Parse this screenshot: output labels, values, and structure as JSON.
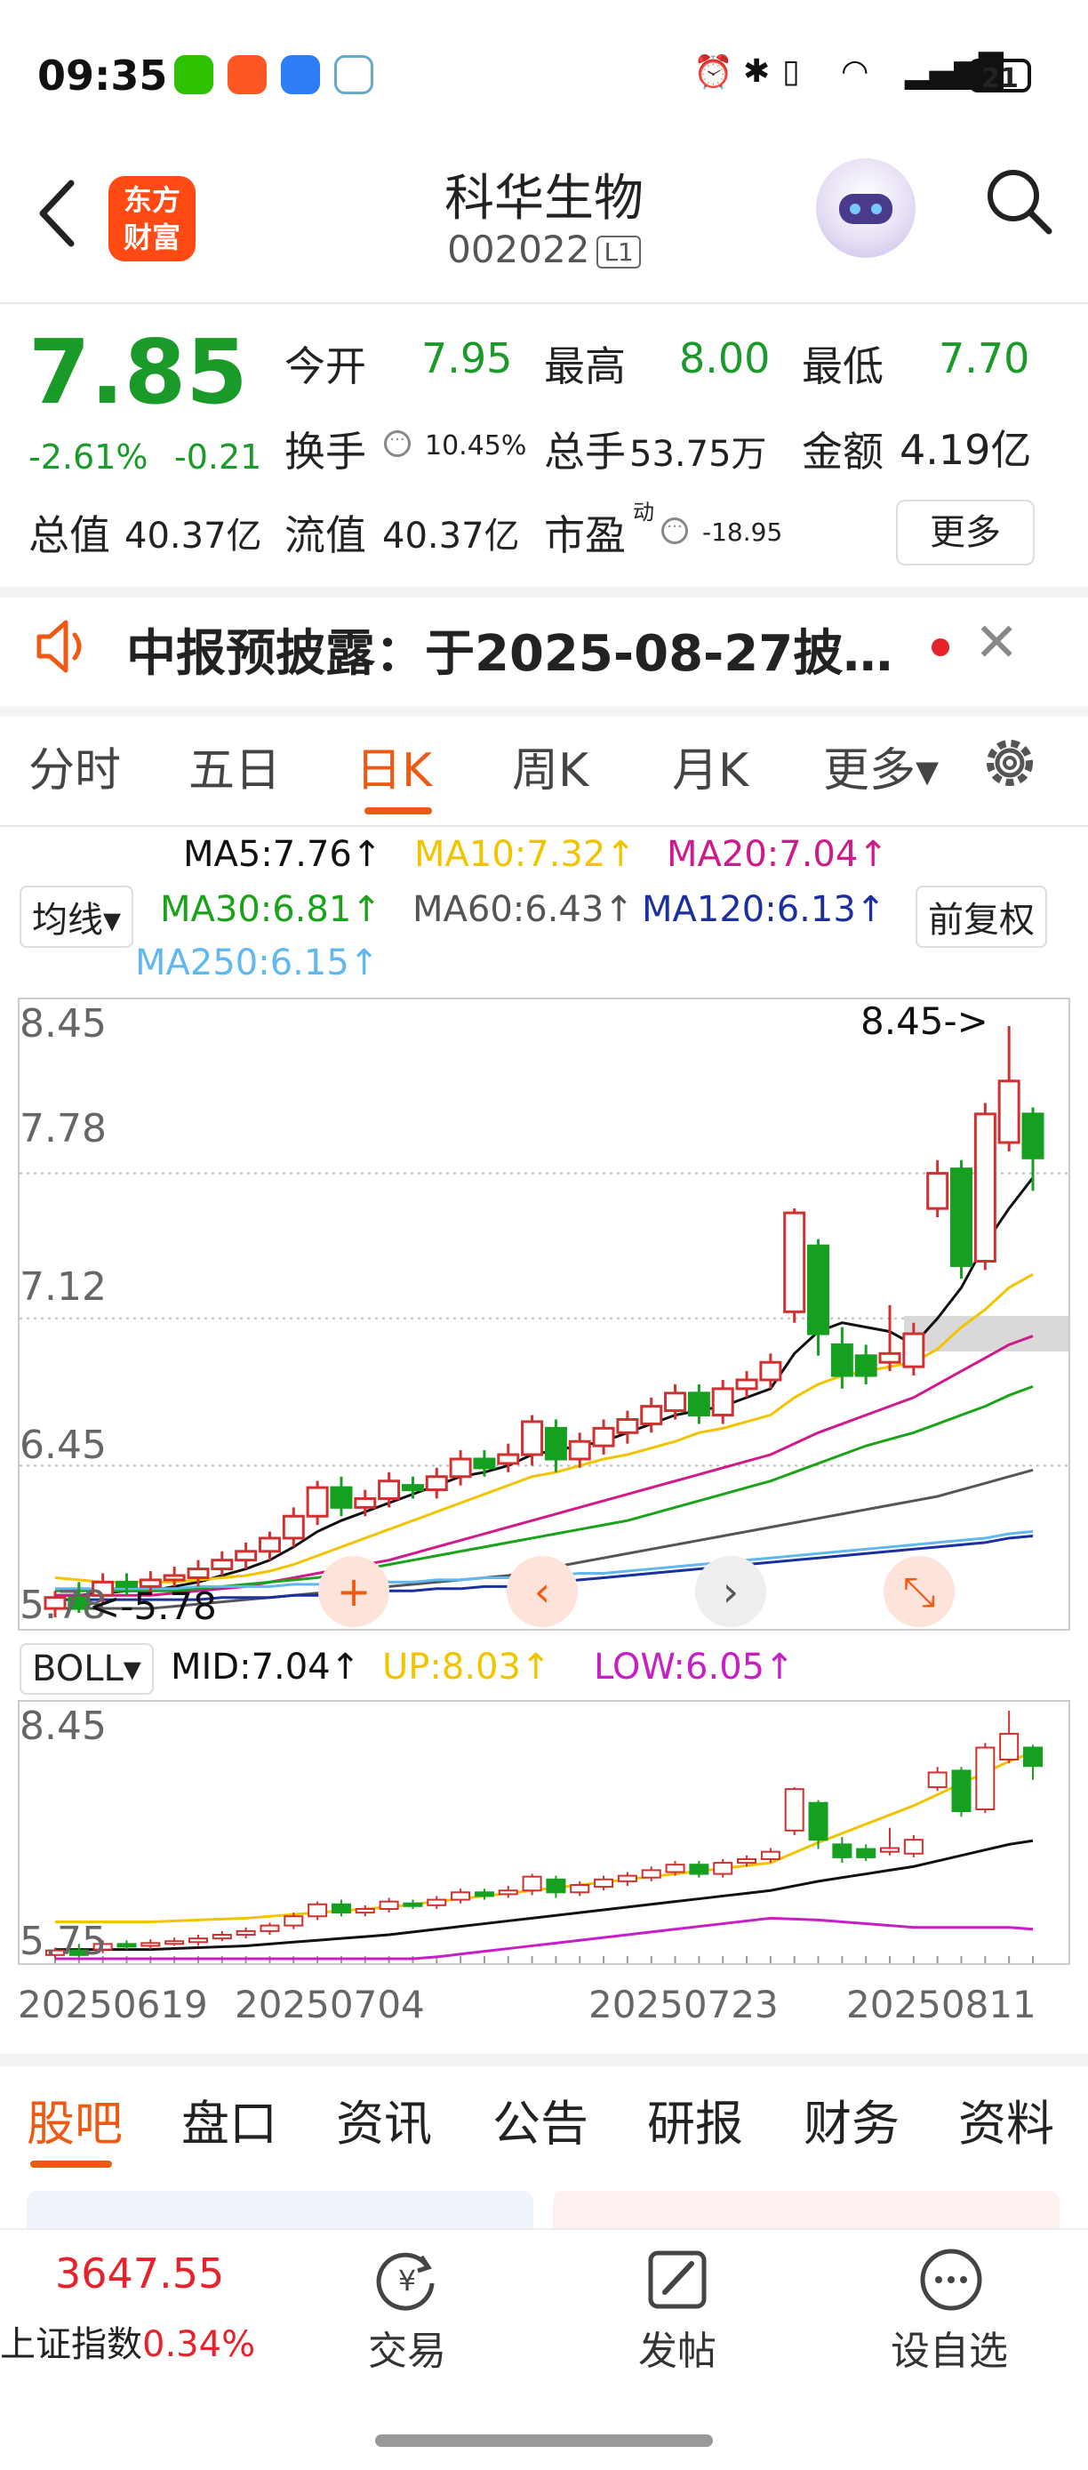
{
  "status_bar": {
    "time": "09:35",
    "battery": "21"
  },
  "header": {
    "back_icon": "chevron-left-icon",
    "logo_line1": "东方",
    "logo_line2": "财富",
    "title": "科华生物",
    "code": "002022",
    "badge": "L1"
  },
  "quote": {
    "price": "7.85",
    "change_pct": "-2.61%",
    "change": "-0.21",
    "open_label": "今开",
    "open": "7.95",
    "high_label": "最高",
    "high": "8.00",
    "low_label": "最低",
    "low": "7.70",
    "turnover_label": "换手",
    "turnover": "10.45%",
    "volume_label": "总手",
    "volume": "53.75万",
    "amount_label": "金额",
    "amount": "4.19亿",
    "mktcap_label": "总值",
    "mktcap": "40.37亿",
    "float_label": "流值",
    "float_cap": "40.37亿",
    "pe_label": "市盈",
    "pe_sup": "动",
    "pe": "-18.95",
    "more": "更多"
  },
  "notice": {
    "text": "中报预披露：于2025-08-27披…",
    "colors": {
      "accent": "#ee5a14",
      "dot": "#e6222a"
    }
  },
  "tabs": [
    {
      "label": "分时"
    },
    {
      "label": "五日"
    },
    {
      "label": "日K"
    },
    {
      "label": "周K"
    },
    {
      "label": "月K"
    },
    {
      "label": "更多▾"
    }
  ],
  "indicators": {
    "ma5": "MA5:7.76↑",
    "ma10": "MA10:7.32↑",
    "ma20": "MA20:7.04↑",
    "ma30": "MA30:6.81↑",
    "ma60": "MA60:6.43↑",
    "ma120": "MA120:6.13↑",
    "ma250": "MA250:6.15↑",
    "avg_btn": "均线▾",
    "adjust_btn": "前复权",
    "colors": {
      "ma5": "#111111",
      "ma10": "#f2c400",
      "ma20": "#d0198a",
      "ma30": "#1aa31a",
      "ma60": "#555555",
      "ma120": "#1a2fa0",
      "ma250": "#5fb8f0"
    }
  },
  "chart_main": {
    "y_labels": [
      "8.45",
      "7.78",
      "7.12",
      "6.45",
      "5.78"
    ],
    "high_marker": "8.45->",
    "low_marker": "<-5.78"
  },
  "boll": {
    "btn": "BOLL▾",
    "mid": "MID:7.04↑",
    "up": "UP:8.03↑",
    "low": "LOW:6.05↑",
    "y_top": "8.45",
    "y_bottom": "5.75"
  },
  "x_labels": [
    "20250619",
    "20250704",
    "20250723",
    "20250811"
  ],
  "bottom_tabs": [
    {
      "label": "股吧"
    },
    {
      "label": "盘口"
    },
    {
      "label": "资讯"
    },
    {
      "label": "公告"
    },
    {
      "label": "研报"
    },
    {
      "label": "财务"
    },
    {
      "label": "资料"
    }
  ],
  "bottom_nav": {
    "index_value": "3647.55",
    "index_label": "上证指数",
    "index_change": "0.34%",
    "trade": "交易",
    "post": "发帖",
    "watch": "设自选"
  },
  "chart_data": {
    "type": "candlestick",
    "x_labels": [
      "20250619",
      "20250704",
      "20250723",
      "20250811"
    ],
    "ylim": [
      5.78,
      8.45
    ],
    "candles": [
      {
        "o": 5.8,
        "c": 5.85,
        "h": 5.88,
        "l": 5.76
      },
      {
        "o": 5.85,
        "c": 5.8,
        "h": 5.92,
        "l": 5.78
      },
      {
        "o": 5.86,
        "c": 5.92,
        "h": 5.96,
        "l": 5.82
      },
      {
        "o": 5.92,
        "c": 5.9,
        "h": 5.96,
        "l": 5.86
      },
      {
        "o": 5.9,
        "c": 5.93,
        "h": 5.97,
        "l": 5.86
      },
      {
        "o": 5.93,
        "c": 5.95,
        "h": 5.99,
        "l": 5.9
      },
      {
        "o": 5.94,
        "c": 5.98,
        "h": 6.02,
        "l": 5.9
      },
      {
        "o": 5.98,
        "c": 6.02,
        "h": 6.06,
        "l": 5.95
      },
      {
        "o": 6.02,
        "c": 6.06,
        "h": 6.1,
        "l": 5.98
      },
      {
        "o": 6.06,
        "c": 6.12,
        "h": 6.15,
        "l": 6.02
      },
      {
        "o": 6.12,
        "c": 6.22,
        "h": 6.26,
        "l": 6.08
      },
      {
        "o": 6.22,
        "c": 6.35,
        "h": 6.38,
        "l": 6.18
      },
      {
        "o": 6.35,
        "c": 6.26,
        "h": 6.4,
        "l": 6.22
      },
      {
        "o": 6.26,
        "c": 6.3,
        "h": 6.34,
        "l": 6.22
      },
      {
        "o": 6.3,
        "c": 6.38,
        "h": 6.42,
        "l": 6.26
      },
      {
        "o": 6.36,
        "c": 6.34,
        "h": 6.4,
        "l": 6.3
      },
      {
        "o": 6.34,
        "c": 6.4,
        "h": 6.44,
        "l": 6.3
      },
      {
        "o": 6.4,
        "c": 6.48,
        "h": 6.52,
        "l": 6.36
      },
      {
        "o": 6.48,
        "c": 6.44,
        "h": 6.52,
        "l": 6.4
      },
      {
        "o": 6.46,
        "c": 6.5,
        "h": 6.55,
        "l": 6.42
      },
      {
        "o": 6.5,
        "c": 6.65,
        "h": 6.68,
        "l": 6.45
      },
      {
        "o": 6.62,
        "c": 6.48,
        "h": 6.66,
        "l": 6.42
      },
      {
        "o": 6.48,
        "c": 6.56,
        "h": 6.6,
        "l": 6.44
      },
      {
        "o": 6.54,
        "c": 6.62,
        "h": 6.66,
        "l": 6.5
      },
      {
        "o": 6.6,
        "c": 6.66,
        "h": 6.7,
        "l": 6.55
      },
      {
        "o": 6.64,
        "c": 6.72,
        "h": 6.76,
        "l": 6.6
      },
      {
        "o": 6.7,
        "c": 6.78,
        "h": 6.82,
        "l": 6.66
      },
      {
        "o": 6.78,
        "c": 6.68,
        "h": 6.82,
        "l": 6.64
      },
      {
        "o": 6.68,
        "c": 6.8,
        "h": 6.84,
        "l": 6.64
      },
      {
        "o": 6.8,
        "c": 6.84,
        "h": 6.88,
        "l": 6.76
      },
      {
        "o": 6.84,
        "c": 6.92,
        "h": 6.96,
        "l": 6.8
      },
      {
        "o": 7.15,
        "c": 7.6,
        "h": 7.62,
        "l": 7.1
      },
      {
        "o": 7.45,
        "c": 7.05,
        "h": 7.48,
        "l": 6.95
      },
      {
        "o": 7.0,
        "c": 6.86,
        "h": 7.08,
        "l": 6.8
      },
      {
        "o": 6.95,
        "c": 6.86,
        "h": 7.0,
        "l": 6.82
      },
      {
        "o": 6.92,
        "c": 6.96,
        "h": 7.18,
        "l": 6.88
      },
      {
        "o": 6.9,
        "c": 7.05,
        "h": 7.1,
        "l": 6.86
      },
      {
        "o": 7.62,
        "c": 7.78,
        "h": 7.84,
        "l": 7.58
      },
      {
        "o": 7.8,
        "c": 7.36,
        "h": 7.84,
        "l": 7.3
      },
      {
        "o": 7.38,
        "c": 8.05,
        "h": 8.1,
        "l": 7.34
      },
      {
        "o": 7.92,
        "c": 8.2,
        "h": 8.45,
        "l": 7.88
      },
      {
        "o": 8.05,
        "c": 7.85,
        "h": 8.08,
        "l": 7.7
      }
    ],
    "series": [
      {
        "name": "MA5",
        "values": [
          5.86,
          5.86,
          5.87,
          5.88,
          5.88,
          5.9,
          5.92,
          5.95,
          5.98,
          6.02,
          6.08,
          6.15,
          6.2,
          6.24,
          6.28,
          6.32,
          6.36,
          6.4,
          6.42,
          6.45,
          6.5,
          6.52,
          6.54,
          6.56,
          6.6,
          6.64,
          6.68,
          6.7,
          6.72,
          6.76,
          6.8,
          6.96,
          7.06,
          7.1,
          7.08,
          7.06,
          7.0,
          7.12,
          7.26,
          7.46,
          7.62,
          7.76
        ]
      },
      {
        "name": "MA10",
        "values": [
          5.94,
          5.93,
          5.92,
          5.92,
          5.92,
          5.92,
          5.93,
          5.94,
          5.95,
          5.97,
          6.0,
          6.04,
          6.08,
          6.12,
          6.16,
          6.2,
          6.24,
          6.28,
          6.32,
          6.36,
          6.4,
          6.42,
          6.45,
          6.48,
          6.5,
          6.53,
          6.56,
          6.6,
          6.62,
          6.65,
          6.68,
          6.76,
          6.82,
          6.86,
          6.88,
          6.9,
          6.92,
          6.98,
          7.08,
          7.16,
          7.26,
          7.32
        ]
      },
      {
        "name": "MA20",
        "values": [
          5.86,
          5.86,
          5.86,
          5.86,
          5.86,
          5.87,
          5.88,
          5.89,
          5.9,
          5.92,
          5.94,
          5.96,
          5.98,
          6.0,
          6.02,
          6.05,
          6.08,
          6.11,
          6.14,
          6.17,
          6.2,
          6.23,
          6.26,
          6.29,
          6.32,
          6.35,
          6.38,
          6.41,
          6.44,
          6.47,
          6.5,
          6.55,
          6.6,
          6.64,
          6.68,
          6.72,
          6.76,
          6.82,
          6.88,
          6.94,
          7.0,
          7.04
        ]
      },
      {
        "name": "MA30",
        "values": [
          5.88,
          5.88,
          5.88,
          5.88,
          5.88,
          5.88,
          5.89,
          5.9,
          5.91,
          5.92,
          5.93,
          5.94,
          5.96,
          5.98,
          6.0,
          6.02,
          6.04,
          6.06,
          6.08,
          6.1,
          6.12,
          6.14,
          6.16,
          6.18,
          6.2,
          6.23,
          6.26,
          6.29,
          6.32,
          6.35,
          6.38,
          6.42,
          6.46,
          6.5,
          6.54,
          6.57,
          6.6,
          6.64,
          6.68,
          6.72,
          6.77,
          6.81
        ]
      },
      {
        "name": "MA60",
        "values": [
          5.8,
          5.8,
          5.8,
          5.8,
          5.8,
          5.81,
          5.82,
          5.83,
          5.84,
          5.85,
          5.86,
          5.87,
          5.88,
          5.89,
          5.9,
          5.91,
          5.92,
          5.93,
          5.94,
          5.95,
          5.97,
          5.99,
          6.01,
          6.03,
          6.05,
          6.07,
          6.09,
          6.11,
          6.13,
          6.15,
          6.17,
          6.19,
          6.21,
          6.23,
          6.25,
          6.27,
          6.29,
          6.31,
          6.34,
          6.37,
          6.4,
          6.43
        ]
      },
      {
        "name": "MA120",
        "values": [
          5.84,
          5.84,
          5.84,
          5.84,
          5.84,
          5.84,
          5.84,
          5.85,
          5.85,
          5.85,
          5.86,
          5.86,
          5.87,
          5.87,
          5.88,
          5.88,
          5.89,
          5.89,
          5.9,
          5.9,
          5.91,
          5.92,
          5.93,
          5.94,
          5.95,
          5.96,
          5.97,
          5.98,
          5.99,
          6.0,
          6.01,
          6.02,
          6.03,
          6.04,
          6.05,
          6.06,
          6.07,
          6.08,
          6.09,
          6.1,
          6.12,
          6.13
        ]
      },
      {
        "name": "MA250",
        "values": [
          5.89,
          5.89,
          5.89,
          5.89,
          5.89,
          5.89,
          5.9,
          5.9,
          5.9,
          5.9,
          5.91,
          5.91,
          5.91,
          5.92,
          5.92,
          5.92,
          5.93,
          5.93,
          5.94,
          5.94,
          5.95,
          5.95,
          5.96,
          5.96,
          5.97,
          5.98,
          5.99,
          6.0,
          6.01,
          6.02,
          6.03,
          6.04,
          6.05,
          6.06,
          6.07,
          6.08,
          6.09,
          6.1,
          6.11,
          6.12,
          6.14,
          6.15
        ]
      }
    ]
  }
}
